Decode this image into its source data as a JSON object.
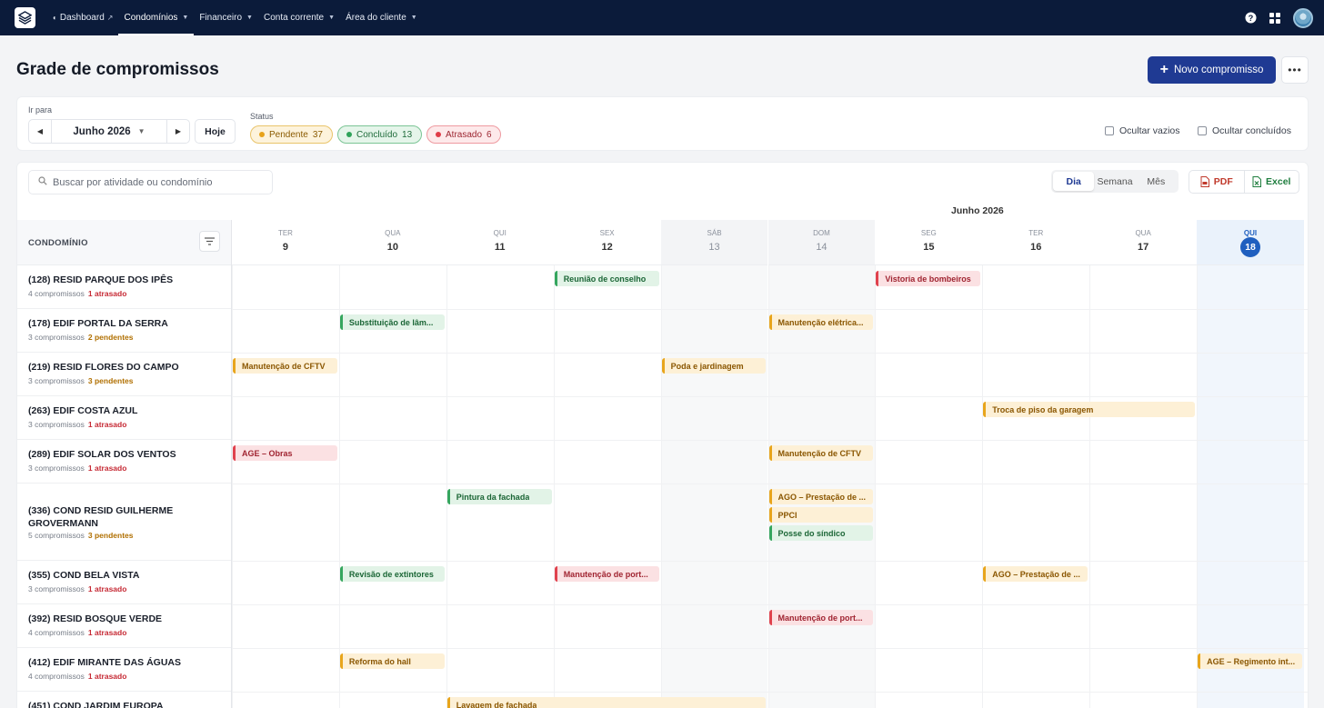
{
  "nav": {
    "items": [
      {
        "label": "Dashboard",
        "active": false
      },
      {
        "label": "Condomínios",
        "active": true
      },
      {
        "label": "Financeiro",
        "active": false
      },
      {
        "label": "Conta corrente",
        "active": false
      },
      {
        "label": "Área do cliente",
        "active": false
      }
    ]
  },
  "header": {
    "title": "Grade de compromissos",
    "new_button": "Novo compromisso"
  },
  "filters": {
    "goto_label": "Ir para",
    "month": "Junho 2026",
    "today_button": "Hoje",
    "status_label": "Status",
    "chips": [
      {
        "label": "Pendente",
        "count": "37"
      },
      {
        "label": "Concluído",
        "count": "13"
      },
      {
        "label": "Atrasado",
        "count": "6"
      }
    ],
    "hide_empty": "Ocultar vazios",
    "hide_done": "Ocultar concluídos"
  },
  "toolbar": {
    "search_placeholder": "Buscar por atividade ou condomínio",
    "views": [
      "Dia",
      "Semana",
      "Mês"
    ],
    "selected_view": "Dia",
    "pdf": "PDF",
    "excel": "Excel"
  },
  "grid": {
    "month_label": "Junho 2026",
    "column_header": "CONDOMÍNIO",
    "days": [
      {
        "dow": "TER",
        "num": "9"
      },
      {
        "dow": "QUA",
        "num": "10"
      },
      {
        "dow": "QUI",
        "num": "11"
      },
      {
        "dow": "SEX",
        "num": "12"
      },
      {
        "dow": "SÁB",
        "num": "13"
      },
      {
        "dow": "DOM",
        "num": "14"
      },
      {
        "dow": "SEG",
        "num": "15"
      },
      {
        "dow": "TER",
        "num": "16"
      },
      {
        "dow": "QUA",
        "num": "17"
      },
      {
        "dow": "QUI",
        "num": "18"
      }
    ],
    "rows": [
      {
        "name": "(128) RESID PARQUE DOS IPÊS",
        "count": "4 compromissos",
        "status": "1 atrasado",
        "status_type": "atr"
      },
      {
        "name": "(178) EDIF PORTAL DA SERRA",
        "count": "3 compromissos",
        "status": "2 pendentes",
        "status_type": "pend"
      },
      {
        "name": "(219) RESID FLORES DO CAMPO",
        "count": "3 compromissos",
        "status": "3 pendentes",
        "status_type": "pend"
      },
      {
        "name": "(263) EDIF COSTA AZUL",
        "count": "3 compromissos",
        "status": "1 atrasado",
        "status_type": "atr"
      },
      {
        "name": "(289) EDIF SOLAR DOS VENTOS",
        "count": "3 compromissos",
        "status": "1 atrasado",
        "status_type": "atr"
      },
      {
        "name": "(336) COND RESID GUILHERME GROVERMANN",
        "count": "5 compromissos",
        "status": "3 pendentes",
        "status_type": "pend"
      },
      {
        "name": "(355) COND BELA VISTA",
        "count": "3 compromissos",
        "status": "1 atrasado",
        "status_type": "atr"
      },
      {
        "name": "(392) RESID BOSQUE VERDE",
        "count": "4 compromissos",
        "status": "1 atrasado",
        "status_type": "atr"
      },
      {
        "name": "(412) EDIF MIRANTE DAS ÁGUAS",
        "count": "4 compromissos",
        "status": "1 atrasado",
        "status_type": "atr"
      },
      {
        "name": "(451) COND JARDIM EUROPA",
        "count": "",
        "status": "",
        "status_type": ""
      }
    ],
    "events": [
      {
        "row": 0,
        "day": 3,
        "span": 1,
        "stack": 0,
        "label": "Reunião de conselho",
        "type": "conc"
      },
      {
        "row": 0,
        "day": 6,
        "span": 1,
        "stack": 0,
        "label": "Vistoria de bombeiros",
        "type": "atr"
      },
      {
        "row": 1,
        "day": 1,
        "span": 1,
        "stack": 0,
        "label": "Substituição de lâm...",
        "type": "conc"
      },
      {
        "row": 1,
        "day": 5,
        "span": 1,
        "stack": 0,
        "label": "Manutenção elétrica...",
        "type": "pend"
      },
      {
        "row": 2,
        "day": 0,
        "span": 1,
        "stack": 0,
        "label": "Manutenção de CFTV",
        "type": "pend"
      },
      {
        "row": 2,
        "day": 4,
        "span": 1,
        "stack": 0,
        "label": "Poda e jardinagem",
        "type": "pend"
      },
      {
        "row": 3,
        "day": 7,
        "span": 2,
        "stack": 0,
        "label": "Troca de piso da garagem",
        "type": "pend"
      },
      {
        "row": 4,
        "day": 0,
        "span": 1,
        "stack": 0,
        "label": "AGE – Obras",
        "type": "atr"
      },
      {
        "row": 4,
        "day": 5,
        "span": 1,
        "stack": 0,
        "label": "Manutenção de CFTV",
        "type": "pend"
      },
      {
        "row": 5,
        "day": 2,
        "span": 1,
        "stack": 0,
        "label": "Pintura da fachada",
        "type": "conc"
      },
      {
        "row": 5,
        "day": 5,
        "span": 1,
        "stack": 0,
        "label": "AGO – Prestação de ...",
        "type": "pend"
      },
      {
        "row": 5,
        "day": 5,
        "span": 1,
        "stack": 1,
        "label": "PPCI",
        "type": "pend"
      },
      {
        "row": 5,
        "day": 5,
        "span": 1,
        "stack": 2,
        "label": "Posse do síndico",
        "type": "conc"
      },
      {
        "row": 6,
        "day": 1,
        "span": 1,
        "stack": 0,
        "label": "Revisão de extintores",
        "type": "conc"
      },
      {
        "row": 6,
        "day": 3,
        "span": 1,
        "stack": 0,
        "label": "Manutenção de port...",
        "type": "atr"
      },
      {
        "row": 6,
        "day": 7,
        "span": 1,
        "stack": 0,
        "label": "AGO – Prestação de ...",
        "type": "pend"
      },
      {
        "row": 7,
        "day": 5,
        "span": 1,
        "stack": 0,
        "label": "Manutenção de port...",
        "type": "atr"
      },
      {
        "row": 8,
        "day": 1,
        "span": 1,
        "stack": 0,
        "label": "Reforma do hall",
        "type": "pend"
      },
      {
        "row": 8,
        "day": 9,
        "span": 1,
        "stack": 0,
        "label": "AGE – Regimento int...",
        "type": "pend"
      },
      {
        "row": 9,
        "day": 2,
        "span": 3,
        "stack": 0,
        "label": "Lavagem de fachada",
        "type": "pend"
      }
    ]
  }
}
